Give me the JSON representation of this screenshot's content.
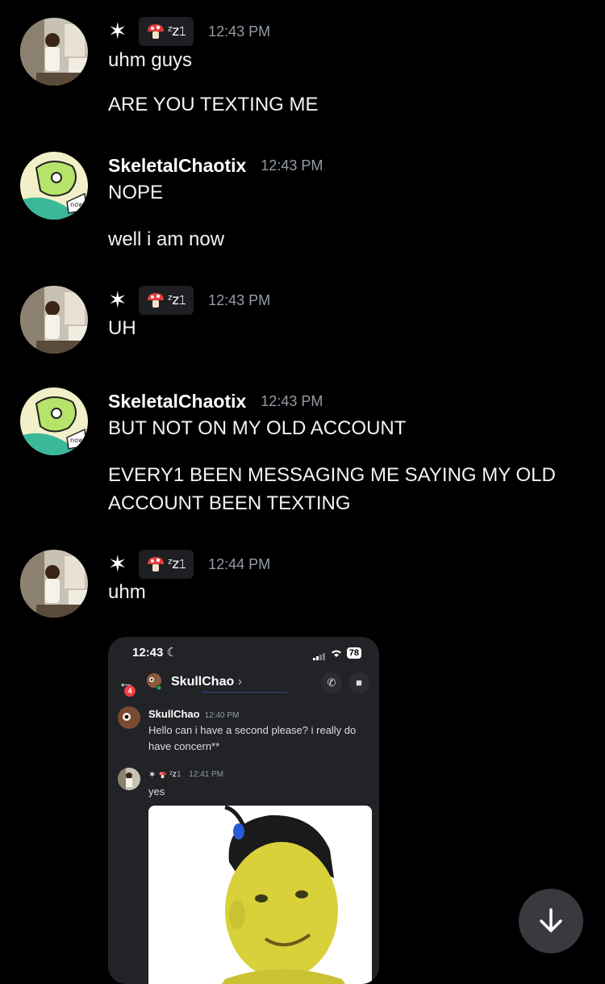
{
  "messages": [
    {
      "author_symbol": "✶",
      "tag_text": "ᶻz𝟷",
      "time": "12:43 PM",
      "lines": [
        "uhm guys",
        "ARE YOU TEXTING ME"
      ]
    },
    {
      "author": "SkeletalChaotix",
      "time": "12:43 PM",
      "lines": [
        "NOPE",
        "well i am now"
      ]
    },
    {
      "author_symbol": "✶",
      "tag_text": "ᶻz𝟷",
      "time": "12:43 PM",
      "lines": [
        "UH"
      ]
    },
    {
      "author": "SkeletalChaotix",
      "time": "12:43 PM",
      "lines": [
        "BUT NOT ON MY OLD ACCOUNT",
        "EVERY1 BEEN MESSAGING ME SAYING MY OLD",
        "ACCOUNT BEEN TEXTING"
      ]
    },
    {
      "author_symbol": "✶",
      "tag_text": "ᶻz𝟷",
      "time": "12:44 PM",
      "lines": [
        "uhm"
      ]
    }
  ],
  "attachment": {
    "status_time": "12:43",
    "moon": "☾",
    "battery": "78",
    "badge": "4",
    "dm_name": "SkullChao",
    "chevron": "›",
    "msg1": {
      "author": "SkullChao",
      "time": "12:40 PM",
      "text": "Hello can i have a second please? i really do have concern**"
    },
    "msg2": {
      "author_symbol": "✶",
      "tag_text": "ᶻz𝟷",
      "time": "12:41 PM",
      "text": "yes"
    }
  },
  "icons": {
    "star": "star-icon",
    "mushroom": "mushroom-icon",
    "scroll_down": "arrow-down-icon",
    "back": "back-arrow-icon",
    "phone": "phone-icon",
    "video": "video-icon"
  },
  "colors": {
    "background": "#000000",
    "timestamp": "#949ba4",
    "tag_bg": "#1e1f22",
    "scroll_btn": "#383a40"
  }
}
